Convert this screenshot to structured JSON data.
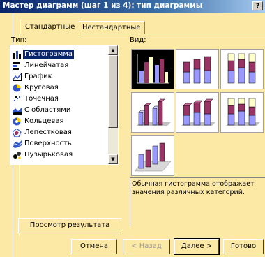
{
  "window": {
    "title": "Мастер диаграмм (шаг 1 из 4): тип диаграммы",
    "help_label": "?"
  },
  "tabs": [
    {
      "label": "Стандартные",
      "active": true
    },
    {
      "label": "Нестандартные",
      "active": false
    }
  ],
  "type_label": "Тип:",
  "view_label": "Вид:",
  "chart_types": [
    {
      "label": "Гистограмма",
      "icon": "column-chart-icon",
      "selected": true
    },
    {
      "label": "Линейчатая",
      "icon": "bar-chart-icon"
    },
    {
      "label": "График",
      "icon": "line-chart-icon"
    },
    {
      "label": "Круговая",
      "icon": "pie-chart-icon"
    },
    {
      "label": "Точечная",
      "icon": "scatter-chart-icon"
    },
    {
      "label": "С областями",
      "icon": "area-chart-icon"
    },
    {
      "label": "Кольцевая",
      "icon": "doughnut-chart-icon"
    },
    {
      "label": "Лепестковая",
      "icon": "radar-chart-icon"
    },
    {
      "label": "Поверхность",
      "icon": "surface-chart-icon"
    },
    {
      "label": "Пузырьковая",
      "icon": "bubble-chart-icon"
    }
  ],
  "subtypes": [
    {
      "name": "clustered-column",
      "selected": true
    },
    {
      "name": "stacked-column"
    },
    {
      "name": "100-stacked-column"
    },
    {
      "name": "3d-clustered-column"
    },
    {
      "name": "3d-stacked-column"
    },
    {
      "name": "3d-100-stacked-column"
    },
    {
      "name": "3d-column"
    }
  ],
  "description": "Обычная гистограмма отображает значения различных категорий.",
  "preview_button": "Просмотр результата",
  "buttons": {
    "cancel": "Отмена",
    "back": "< Назад",
    "next": "Далее >",
    "finish": "Готово"
  },
  "colors": {
    "series1": "#9999ff",
    "series2": "#993366",
    "series3": "#ffffcc",
    "selection": "#0a246a"
  }
}
